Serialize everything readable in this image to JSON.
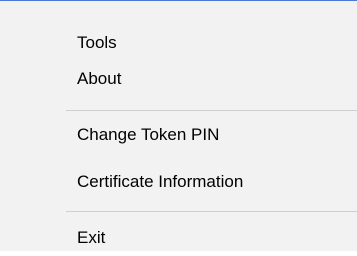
{
  "context_menu": {
    "items": [
      {
        "label": "Tools"
      },
      {
        "label": "About"
      },
      {
        "label": "Change Token PIN"
      },
      {
        "label": "Certificate Information"
      },
      {
        "label": "Exit"
      }
    ]
  },
  "colors": {
    "menu_background": "#f2f2f2",
    "top_border": "#4a78d4",
    "separator": "#cfcfcf",
    "text": "#000000"
  }
}
